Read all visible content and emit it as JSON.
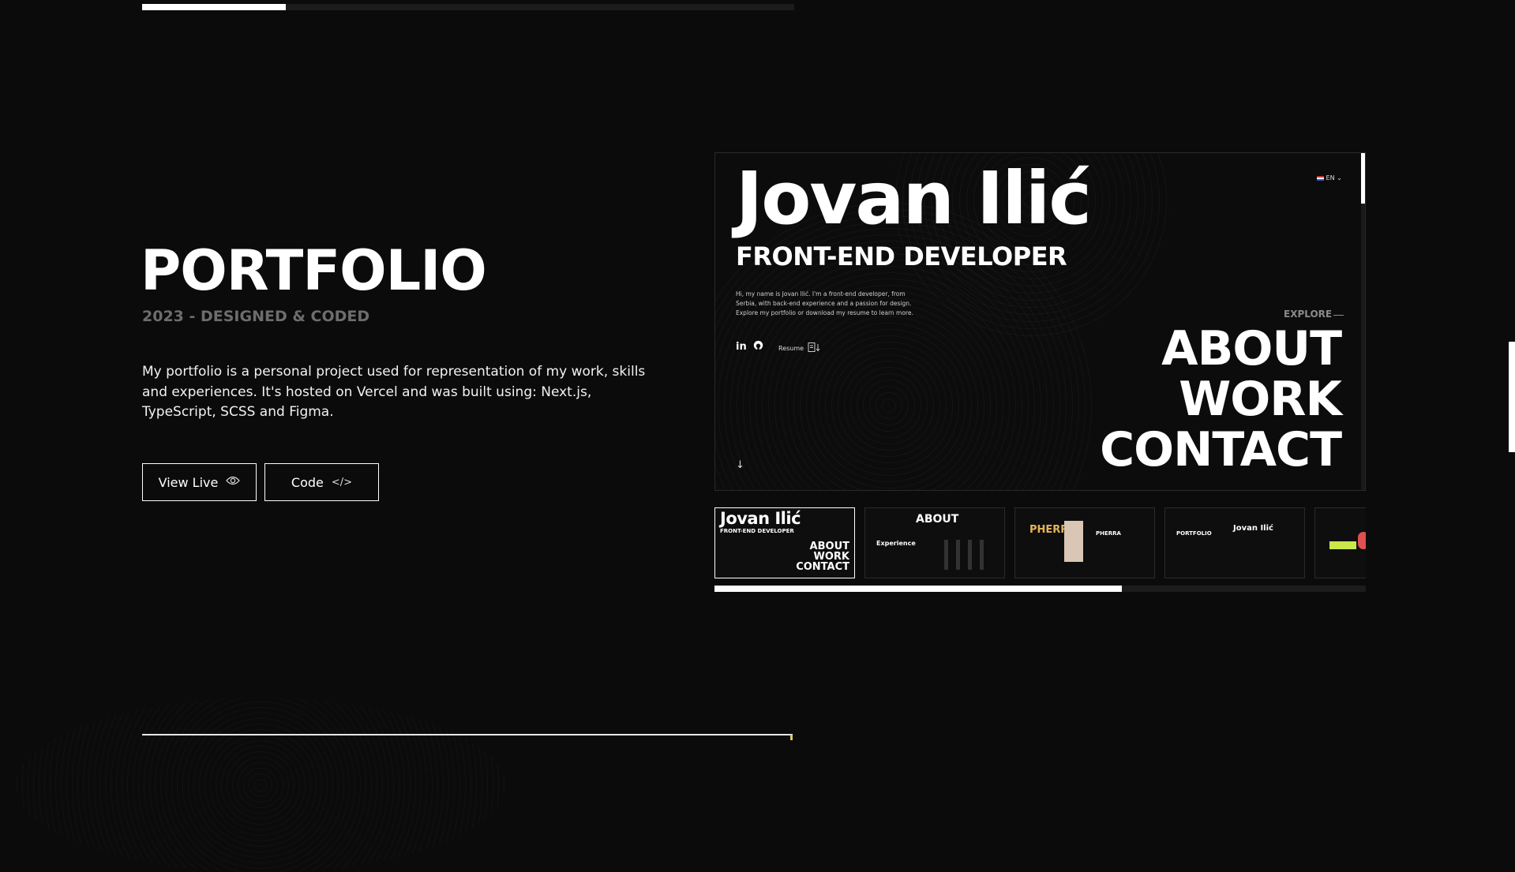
{
  "project": {
    "title": "PORTFOLIO",
    "subtitle": "2023 - DESIGNED & CODED",
    "description": "My portfolio is a personal project used for representation of my work, skills and experiences. It's hosted on Vercel and was built using: Next.js, TypeScript, SCSS and Figma.",
    "top_progress": 0.22,
    "buttons": {
      "view_live": "View Live",
      "view_live_icon": "eye-icon",
      "code": "Code",
      "code_icon": "code-icon",
      "code_glyph": "</>"
    }
  },
  "preview": {
    "name": "Jovan Ilić",
    "role": "FRONT-END DEVELOPER",
    "intro": "Hi, my name is Jovan Ilić. I'm a front-end developer, from Serbia, with back-end experience and a passion for design. Explore my portfolio or download my resume to learn more.",
    "social_linkedin": "in",
    "resume_label": "Resume",
    "language": "EN",
    "explore_label": "EXPLORE",
    "nav": [
      "ABOUT",
      "WORK",
      "CONTACT"
    ],
    "scroll_arrow": "↓"
  },
  "thumbnails": {
    "progress": 0.625,
    "items": [
      {
        "title": "Jovan Ilić",
        "subtitle": "FRONT-END DEVELOPER",
        "nav": [
          "ABOUT",
          "WORK",
          "CONTACT"
        ]
      },
      {
        "title": "ABOUT",
        "subtitle": "Experience"
      },
      {
        "title": "PHERRA",
        "subtitle": "PHERRA"
      },
      {
        "title": "PORTFOLIO",
        "subtitle": "Jovan Ilić"
      },
      {
        "title": ""
      }
    ]
  },
  "colors": {
    "background": "#0b0b0b",
    "accent": "#ffffff",
    "muted": "#6d6d6d",
    "thumb_gold": "#e7b35a"
  }
}
